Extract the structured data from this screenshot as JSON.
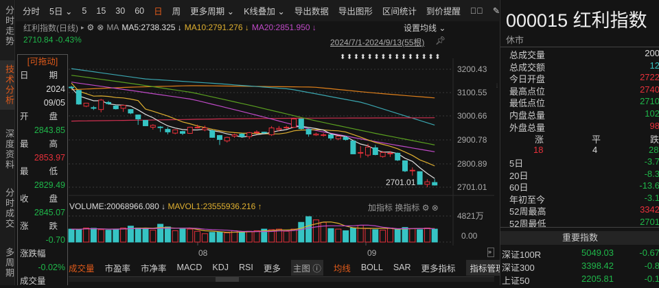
{
  "left_tabs": [
    "分时走势",
    "技术分析",
    "深度资料",
    "分时成交",
    "多周期"
  ],
  "toolbar": {
    "items": [
      "分时",
      "5日 ⌄",
      "5",
      "15",
      "30",
      "60",
      "日",
      "周",
      "更多周期 ⌄",
      "K线叠加 ⌄",
      "导出数据",
      "导出图形",
      "区间统计",
      "到价提醒"
    ],
    "active": "日"
  },
  "legend": {
    "name": "红利指数(日线)",
    "ma": "MA",
    "ma5": "MA5:2738.325 ↓",
    "ma10": "MA10:2791.276 ↓",
    "ma20": "MA20:2851.950 ↓",
    "set_ma": "设置均线 ⌄"
  },
  "price_change": "2710.84 -0.43%",
  "range": "2024/7/1-2024/9/13(55根)",
  "arrows": "⬍⬍⬍⬍⬍⬍⬍⬍⬍⬍⬍⬍⬍⬍⬍",
  "info": {
    "drag": "[可拖动]",
    "date_label": [
      "日",
      "期"
    ],
    "year": "2024",
    "date": "09/05",
    "open_label": [
      "开",
      "盘"
    ],
    "open": "2843.85",
    "high_label": [
      "最",
      "高"
    ],
    "high": "2853.97",
    "low_label": [
      "最",
      "低"
    ],
    "low": "2829.49",
    "close_label": [
      "收",
      "盘"
    ],
    "close": "2845.07",
    "chg_label": [
      "涨",
      "跌"
    ],
    "chg": "-0.70",
    "pct_label": "涨跌幅",
    "pct": "-0.02%",
    "vol_label": "成交量"
  },
  "colors": {
    "up": "#e8303a",
    "down": "#36c4c4",
    "ma5": "#e0e0e0",
    "ma10": "#e0b030",
    "ma20": "#c04ac8",
    "ma30": "#5aa020",
    "ma120": "#3aa6b0",
    "ma250": "#e0801a",
    "flat": "#d03050"
  },
  "chart_data": {
    "type": "candlestick",
    "yticks": [
      "3200.43",
      "3100.55",
      "3000.66",
      "2900.78",
      "2800.89",
      "2701.01"
    ],
    "ylim": [
      2701.01,
      3200.43
    ],
    "xticks": [
      "08",
      "09"
    ],
    "low_annotation": "2701.01",
    "ohlc": [
      [
        3125,
        3130,
        3118,
        3122
      ],
      [
        3111,
        3113,
        3050,
        3053
      ],
      [
        3044,
        3057,
        3040,
        3057
      ],
      [
        3038,
        3045,
        3028,
        3035
      ],
      [
        3030,
        3075,
        3018,
        3070
      ],
      [
        3060,
        3066,
        3050,
        3055
      ],
      [
        3045,
        3050,
        3030,
        3033
      ],
      [
        3035,
        3050,
        3020,
        3048
      ],
      [
        3030,
        3032,
        3010,
        3015
      ],
      [
        3007,
        3008,
        2965,
        2990
      ],
      [
        2984,
        2985,
        2960,
        2961
      ],
      [
        2955,
        2968,
        2945,
        2963
      ],
      [
        2956,
        2960,
        2935,
        2955
      ],
      [
        2946,
        2955,
        2925,
        2935
      ],
      [
        2930,
        2946,
        2925,
        2944
      ],
      [
        2937,
        2940,
        2922,
        2929
      ],
      [
        2929,
        2957,
        2927,
        2955
      ],
      [
        2955,
        2966,
        2950,
        2955
      ],
      [
        2944,
        2962,
        2938,
        2952
      ],
      [
        2940,
        2945,
        2910,
        2912
      ],
      [
        2920,
        2922,
        2880,
        2903
      ],
      [
        2897,
        2915,
        2890,
        2912
      ],
      [
        2917,
        2928,
        2910,
        2923
      ],
      [
        2926,
        2930,
        2913,
        2915
      ],
      [
        2915,
        2935,
        2905,
        2932
      ],
      [
        2932,
        2942,
        2925,
        2935
      ],
      [
        2934,
        2936,
        2928,
        2932
      ],
      [
        2923,
        2960,
        2918,
        2952
      ],
      [
        2945,
        2960,
        2938,
        2950
      ],
      [
        2952,
        2962,
        2948,
        2955
      ],
      [
        2955,
        2995,
        2952,
        2990
      ],
      [
        2990,
        2992,
        2945,
        2949
      ],
      [
        2946,
        2950,
        2915,
        2926
      ],
      [
        2922,
        2932,
        2918,
        2926
      ],
      [
        2920,
        2930,
        2915,
        2923
      ],
      [
        2923,
        2925,
        2900,
        2909
      ],
      [
        2906,
        2920,
        2900,
        2917
      ],
      [
        2912,
        2918,
        2898,
        2903
      ],
      [
        2897,
        2898,
        2842,
        2842
      ],
      [
        2845,
        2875,
        2825,
        2848
      ],
      [
        2837,
        2885,
        2828,
        2871
      ],
      [
        2868,
        2880,
        2836,
        2839
      ],
      [
        2831,
        2854,
        2826,
        2848
      ],
      [
        2843,
        2854,
        2829,
        2845
      ],
      [
        2845,
        2848,
        2812,
        2816
      ],
      [
        2813,
        2814,
        2765,
        2770
      ],
      [
        2770,
        2785,
        2750,
        2773
      ],
      [
        2767,
        2768,
        2713,
        2713
      ],
      [
        2713,
        2735,
        2701,
        2724
      ],
      [
        2721,
        2735,
        2708,
        2710
      ]
    ],
    "ma_lines": {
      "ma30": [
        3175,
        3140,
        3102,
        3045,
        2984,
        2930,
        2880
      ],
      "ma60": [
        3146,
        3110,
        3073,
        3010,
        2943,
        2895,
        2851
      ],
      "ma120": [
        3203,
        3160,
        3140,
        3117,
        3060,
        2964
      ],
      "ma250": [
        3114,
        3125,
        3131,
        3128,
        3125,
        3100,
        3079
      ],
      "flat": [
        2981,
        2985,
        2990,
        2993,
        2994,
        2995
      ]
    },
    "volume": {
      "label": "VOLUME:20068966.080 ↓",
      "mavol": "MAVOL1:23555936.216 ↑",
      "ytick_top": "4821万",
      "ytick_zero": "0.00",
      "max": 4821,
      "values": [
        2400,
        2350,
        2600,
        2550,
        2300,
        2200,
        2400,
        2600,
        2950,
        2600,
        2450,
        2200,
        3300,
        2800,
        2100,
        2400,
        2400,
        2000,
        1550,
        1800,
        1900,
        1700,
        2100,
        1800,
        2000,
        2100,
        2400,
        2300,
        2400,
        2000,
        2400,
        3650,
        4700,
        4100,
        3650,
        2500,
        2400,
        2100,
        2600,
        3100,
        2500,
        2300,
        2200,
        2600,
        2400,
        2700,
        2500,
        2300,
        2600,
        2400
      ]
    }
  },
  "vol_buttons": "加指标  换指标",
  "bottom_bar": {
    "items": [
      "成交量",
      "市盈率",
      "市净率",
      "MACD",
      "KDJ",
      "RSI",
      "更多"
    ],
    "main": "主图 ⓘ",
    "items2": [
      "均线",
      "BOLL",
      "SAR",
      "更多指标"
    ],
    "manage": "指标管理"
  },
  "right": {
    "title": "000015 红利指数",
    "status": "休市",
    "stats": [
      {
        "k": "总成交量",
        "v": "200",
        "c": "wh"
      },
      {
        "k": "总成交额",
        "v": "12",
        "c": "cy"
      },
      {
        "k": "今日开盘",
        "v": "2722",
        "c": "up"
      },
      {
        "k": "最高点位",
        "v": "2740",
        "c": "up"
      },
      {
        "k": "最低点位",
        "v": "2710",
        "c": "dn"
      },
      {
        "k": "内盘总量",
        "v": "102",
        "c": "dn"
      },
      {
        "k": "外盘总量",
        "v": "98",
        "c": "up"
      }
    ],
    "breadth": {
      "labels": [
        "涨",
        "平",
        "跌"
      ],
      "values": [
        "18",
        "4",
        "28"
      ]
    },
    "perf": [
      {
        "k": "5日",
        "v": "-3.7",
        "c": "dn"
      },
      {
        "k": "20日",
        "v": "-8.3",
        "c": "dn"
      },
      {
        "k": "60日",
        "v": "-13.6",
        "c": "dn"
      },
      {
        "k": "年初至今",
        "v": "-3.1",
        "c": "dn"
      },
      {
        "k": "52周最高",
        "v": "3342",
        "c": "up"
      },
      {
        "k": "52周最低",
        "v": "2701",
        "c": "dn"
      }
    ],
    "index_header": "重要指数",
    "indices": [
      {
        "n": "深证100R",
        "p": "5049.03",
        "c": "-0.67"
      },
      {
        "n": "深证300",
        "p": "3398.42",
        "c": "-0.8"
      },
      {
        "n": "上证50",
        "p": "2205.81",
        "c": "-0.1"
      }
    ]
  }
}
